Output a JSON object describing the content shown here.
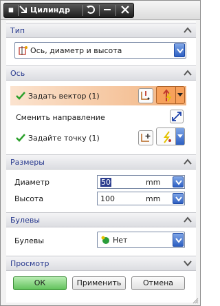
{
  "window": {
    "title": "Цилиндр",
    "accent": "#2b3d8f",
    "ok_color": "#62c25c",
    "selected_row_color": "#f2b481"
  },
  "titlebar_icons": [
    "arrow-pin-icon",
    "reset-icon",
    "minimize-icon",
    "close-icon"
  ],
  "sections": {
    "type": {
      "header": "Тип",
      "dropdown_value": "Ось, диаметр и высота"
    },
    "axis": {
      "header": "Ось",
      "specify_vector": "Задать вектор (1)",
      "reverse_direction": "Сменить направление",
      "specify_point": "Задайте точку (1)"
    },
    "dimensions": {
      "header": "Размеры",
      "diameter_label": "Диаметр",
      "diameter_value": "50",
      "diameter_unit": "mm",
      "height_label": "Высота",
      "height_value": "100",
      "height_unit": "mm"
    },
    "boolean": {
      "header": "Булевы",
      "label": "Булевы",
      "value": "Нет"
    },
    "preview": {
      "header": "Просмотр"
    }
  },
  "footer": {
    "ok": "ОК",
    "apply": "Применить",
    "cancel": "Отмена"
  }
}
